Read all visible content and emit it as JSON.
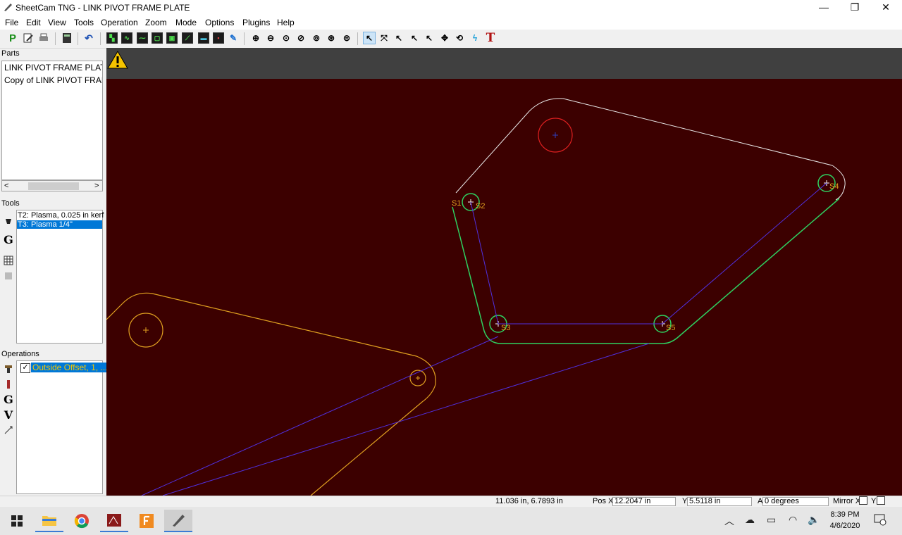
{
  "window": {
    "title": "SheetCam TNG - LINK PIVOT FRAME PLATE",
    "minimize": "—",
    "maximize": "❐",
    "close": "✕"
  },
  "menu": [
    "File",
    "Edit",
    "View",
    "Tools",
    "Operation",
    "Zoom",
    "Mode",
    "Options",
    "Plugins",
    "Help"
  ],
  "toolbar": {
    "icons": [
      "post-process",
      "edit-part",
      "print",
      "calculator",
      "undo",
      "layer-1",
      "layer-2",
      "layer-3",
      "layer-4",
      "layer-5",
      "layer-6",
      "layer-7",
      "layer-8",
      "layer-9",
      "hole-1",
      "hole-2",
      "hole-3",
      "hole-4",
      "hole-5",
      "hole-6",
      "hole-7",
      "select",
      "select-start",
      "select-text",
      "select-nodes",
      "select-arc",
      "move",
      "rotate",
      "lightning",
      "text"
    ],
    "post_label": "P",
    "text_label": "T"
  },
  "parts": {
    "label": "Parts",
    "items": [
      "LINK PIVOT FRAME PLATE",
      "Copy of  LINK PIVOT FRAME PLATE"
    ]
  },
  "tools": {
    "label": "Tools",
    "items": [
      "T2: Plasma, 0.025 in kerf",
      "T3: Plasma 1/4\""
    ],
    "selected_index": 1,
    "g_label": "G"
  },
  "operations": {
    "label": "Operations",
    "items": [
      {
        "label": "Outside Offset, 1, ...",
        "checked": true
      }
    ],
    "g_label": "G",
    "v_label": "V"
  },
  "canvas": {
    "background": "#3c0000",
    "warning_icon": "warning-icon",
    "start_labels": [
      "S1",
      "S2",
      "S3",
      "S4",
      "S5"
    ]
  },
  "status": {
    "coords": "11.036 in, 6.7893 in",
    "pos_x_label": "Pos X",
    "pos_x": "12.2047 in",
    "y_label": "Y",
    "y": "5.5118 in",
    "a_label": "A",
    "a": "0 degrees",
    "mirror_x_label": "Mirror X",
    "mirror_y_label": "Y"
  },
  "taskbar": {
    "time": "8:39 PM",
    "date": "4/6/2020"
  }
}
